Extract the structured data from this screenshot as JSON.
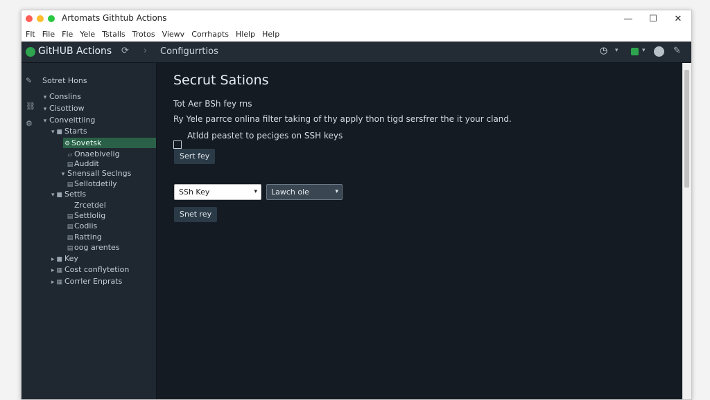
{
  "window": {
    "title": "Artomats Githtub Actions",
    "controls": {
      "minimize": "—",
      "maximize": "☐",
      "close": "✕"
    },
    "traffic_colors": {
      "red": "#ff5f57",
      "yellow": "#febc2e",
      "green": "#28c840"
    }
  },
  "menu": [
    "Flt",
    "File",
    "Fle",
    "Yele",
    "Tstalls",
    "Trotos",
    "Viewv",
    "Corrhapts",
    "Hlelp",
    "Help"
  ],
  "toolbar": {
    "brand": "GitHUB Actions",
    "breadcrumb": "Configurrtios",
    "icons": [
      "refresh-icon",
      "chevron-right-icon",
      "clock-icon",
      "chevron-down-icon",
      "status-icon",
      "chevron-down-icon",
      "avatar-icon",
      "edit-icon"
    ]
  },
  "sidebar": {
    "items": [
      {
        "label": "Sotret Hons",
        "glyph": ""
      },
      {
        "label": "Conslins",
        "glyph": "▾"
      },
      {
        "label": "Cisottiow",
        "glyph": "▾"
      },
      {
        "label": "Conveittiing",
        "glyph": "▾"
      },
      {
        "label": "Starts",
        "glyph": "▾ ■"
      },
      {
        "label": "Sovetsk",
        "glyph": "⚙",
        "selected": true
      },
      {
        "label": "Onaebivelig",
        "glyph": "▱"
      },
      {
        "label": "Auddit",
        "glyph": "▤"
      },
      {
        "label": "Snensall Seclngs",
        "glyph": "▾"
      },
      {
        "label": "Sellotdetily",
        "glyph": "▤"
      },
      {
        "label": "Settls",
        "glyph": "▾ ■"
      },
      {
        "label": "Zrcetdel",
        "glyph": ""
      },
      {
        "label": "Settlolig",
        "glyph": "▤"
      },
      {
        "label": "Codiis",
        "glyph": "▤"
      },
      {
        "label": "Ratting",
        "glyph": "▤"
      },
      {
        "label": "oog arentes",
        "glyph": "▤"
      },
      {
        "label": "Key",
        "glyph": "▸ ■"
      },
      {
        "label": "Cost conflytetion",
        "glyph": "▸ ▦"
      },
      {
        "label": "Corrler Enprats",
        "glyph": "▸ ▦"
      }
    ]
  },
  "main": {
    "title": "Secrut Sations",
    "line1": "Tot Aer BSh fey rns",
    "line2": "Ry Yele parrce onlina filter taking of thy apply thon tigd sersfrer the it your cland.",
    "checkbox_label": "Atldd peastet to peciges on SSH keys",
    "btn_set_key": "Sert fey",
    "select1_value": "SSh Key",
    "select2_value": "Lawch ole",
    "btn_save_key": "Snet rey"
  }
}
